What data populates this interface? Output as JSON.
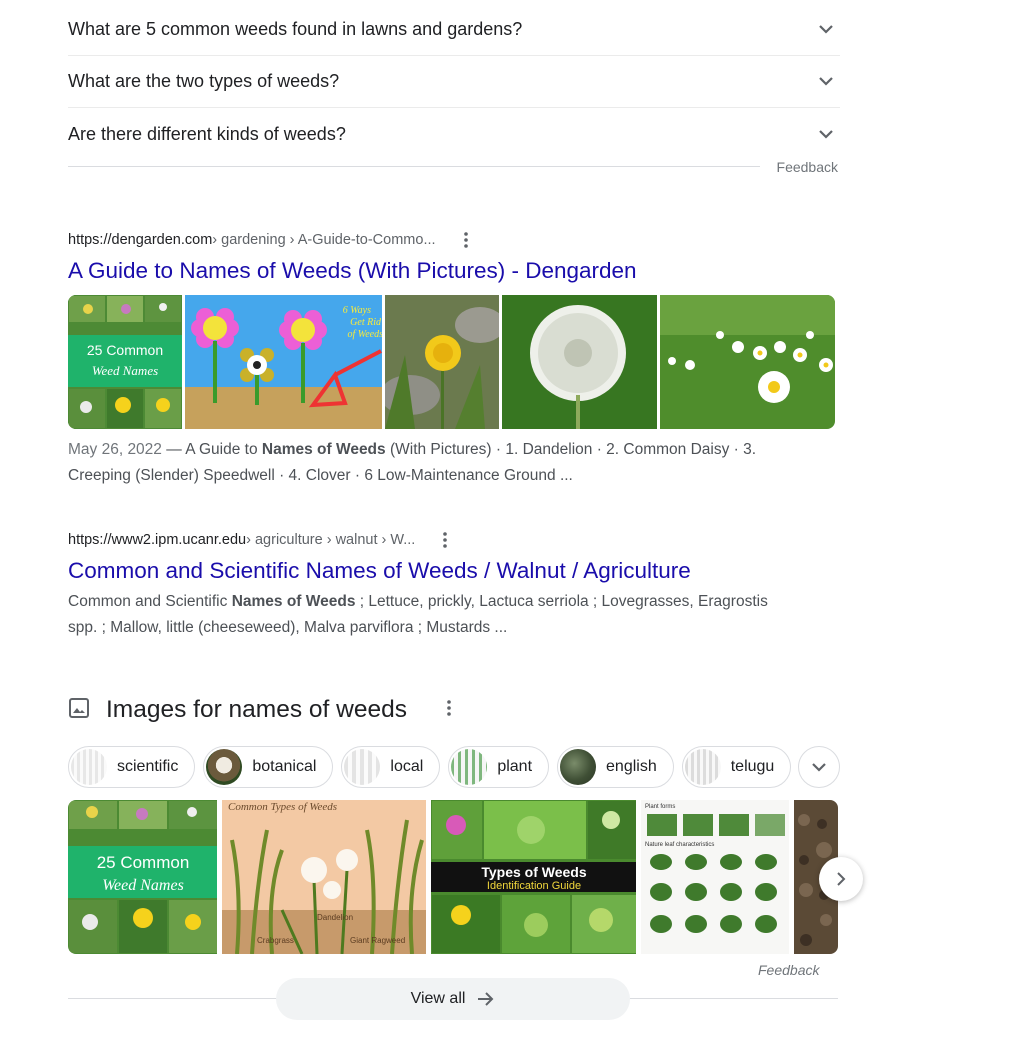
{
  "paa": {
    "questions": [
      "What are 5 common weeds found in lawns and gardens?",
      "What are the two types of weeds?",
      "Are there different kinds of weeds?"
    ],
    "feedback": "Feedback"
  },
  "result1": {
    "domain": "https://dengarden.com",
    "path": " › gardening › A-Guide-to-Commo...",
    "title": "A Guide to Names of Weeds (With Pictures) - Dengarden",
    "thumb_text_1": "25 Common",
    "thumb_text_2": "Weed Names",
    "thumb_text_3": "6 Ways",
    "thumb_text_4": "Get Rid",
    "thumb_text_5": "of Weeds",
    "snippet": {
      "date": "May 26, 2022",
      "pre": " — A Guide to ",
      "bold": "Names of Weeds",
      "post": " (With Pictures) · 1. Dandelion · 2. Common Daisy · 3. Creeping (Slender) Speedwell · 4. Clover · 6 Low-Maintenance Ground ..."
    }
  },
  "result2": {
    "domain": "https://www2.ipm.ucanr.edu",
    "path": " › agriculture › walnut › W...",
    "title": "Common and Scientific Names of Weeds / Walnut / Agriculture",
    "snippet": {
      "pre": "Common and Scientific ",
      "bold": "Names of Weeds",
      "post": " ; Lettuce, prickly, Lactuca serriola ; Lovegrasses, Eragrostis spp. ; Mallow, little (cheeseweed), Malva parviflora ; Mustards ..."
    }
  },
  "images": {
    "heading": "Images for names of weeds",
    "chips": [
      "scientific",
      "botanical",
      "local",
      "plant",
      "english",
      "telugu"
    ],
    "grid_text": {
      "a1": "25 Common",
      "a2": "Weed Names",
      "b1": "Common Types of Weeds",
      "b2": "Dandelion",
      "b3": "Crabgrass",
      "b4": "Giant Ragweed",
      "c1": "Types of Weeds",
      "c2": "Identification Guide",
      "d1": "Plant forms",
      "d2": "Nature leaf characteristics"
    },
    "feedback": "Feedback",
    "view_all": "View all"
  },
  "colors": {
    "link": "#1a0dab",
    "text": "#202124",
    "muted": "#4d5156",
    "green_banner": "#1fb36b"
  }
}
